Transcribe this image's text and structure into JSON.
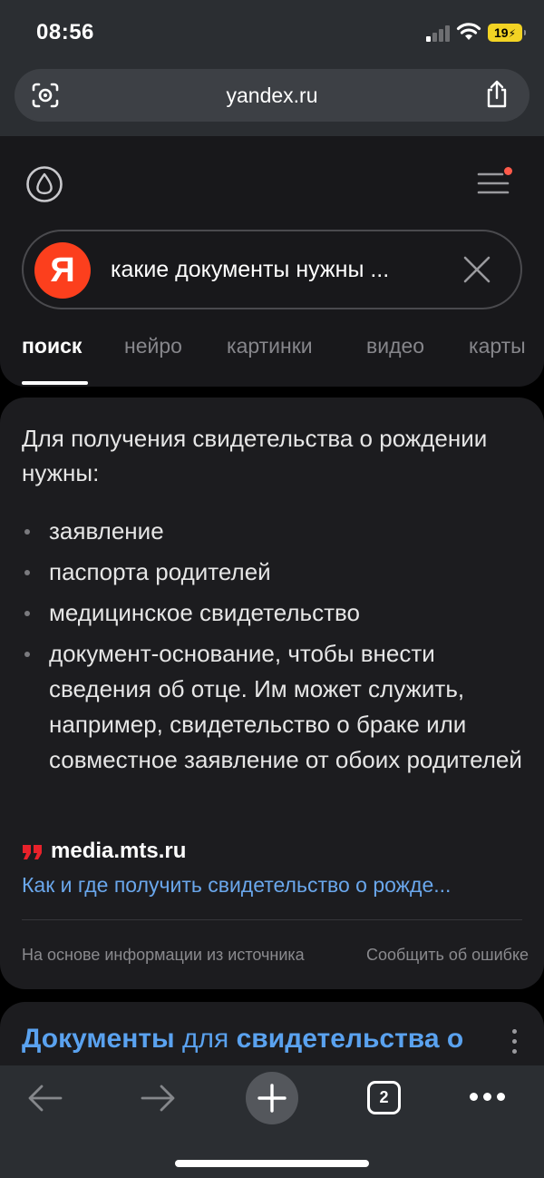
{
  "status_bar": {
    "time": "08:56",
    "battery": "19",
    "icons": [
      "cellular-signal-icon",
      "wifi-icon",
      "battery-charging-icon"
    ]
  },
  "browser": {
    "url": "yandex.ru",
    "tab_count": "2",
    "icons": [
      "lens-icon",
      "share-icon",
      "back-arrow-icon",
      "forward-arrow-icon",
      "plus-icon",
      "tabs-icon",
      "more-dots-icon"
    ]
  },
  "search": {
    "logo_letter": "Я",
    "query": "какие документы нужны ...",
    "tabs": [
      {
        "label": "поиск",
        "active": true
      },
      {
        "label": "нейро",
        "active": false
      },
      {
        "label": "картинки",
        "active": false
      },
      {
        "label": "видео",
        "active": false
      },
      {
        "label": "карты",
        "active": false
      }
    ]
  },
  "answer": {
    "intro": "Для получения свидетельства о рождении нужны:",
    "items": [
      "заявление",
      "паспорта родителей",
      "медицинское свидетельство",
      "документ-основание, чтобы внести сведения об отце. Им может служить, например, свидетельство о браке или совместное заявление от обоих родителей"
    ],
    "source_domain": "media.mts.ru",
    "source_link": "Как и где получить свидетельство о рожде...",
    "footer_note": "На основе информации из источника",
    "report_error": "Сообщить об ошибке"
  },
  "result": {
    "title_part1": "Документы",
    "title_part2": " для ",
    "title_part3": "свидетельства о"
  },
  "colors": {
    "link": "#6aa7ec",
    "yandex_red": "#fc3f1d",
    "battery_yellow": "#f2d324",
    "notification_dot": "#ff5a4a"
  }
}
